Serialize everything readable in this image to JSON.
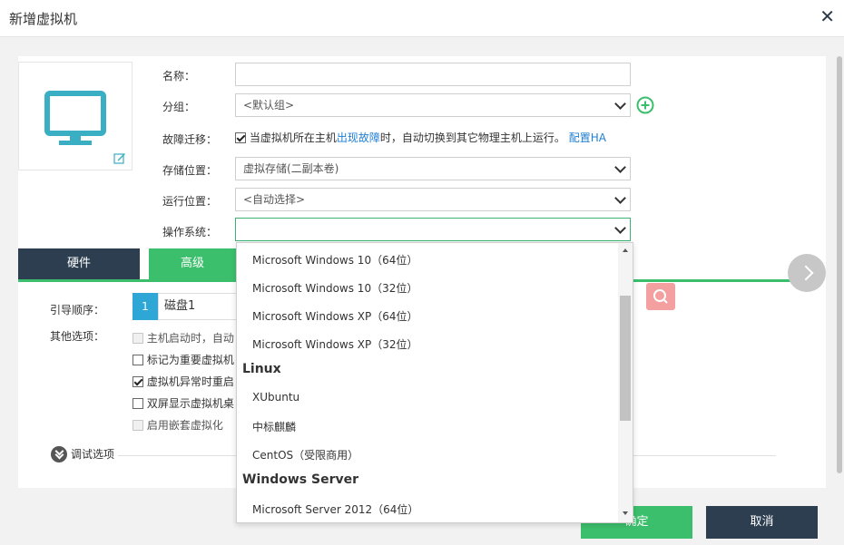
{
  "dialog": {
    "title": "新增虚拟机",
    "close_glyph": "✕"
  },
  "form": {
    "name_label": "名称：",
    "name_value": "",
    "group_label": "分组：",
    "group_value": "<默认组>",
    "failover_label": "故障迁移：",
    "failover_text_1": "当虚拟机所在主机",
    "failover_link_1": "出现故障",
    "failover_text_2": "时，自动切换到其它物理主机上运行。",
    "failover_link_2": "配置HA",
    "failover_checked": true,
    "storage_label": "存储位置：",
    "storage_value": "虚拟存储(二副本卷)",
    "run_label": "运行位置：",
    "run_value": "<自动选择>",
    "os_label": "操作系统：",
    "os_value": ""
  },
  "tabs": {
    "hardware": "硬件",
    "advanced": "高级"
  },
  "advanced": {
    "boot_label": "引导顺序：",
    "boot_index": "1",
    "boot_device": "磁盘1",
    "other_label": "其他选项：",
    "options": [
      {
        "label": "主机启动时，自动",
        "checked": false,
        "disabled": true
      },
      {
        "label": "标记为重要虚拟机",
        "checked": false,
        "disabled": false
      },
      {
        "label": "虚拟机异常时重启",
        "checked": true,
        "disabled": false
      },
      {
        "label": "双屏显示虚拟机桌",
        "checked": false,
        "disabled": false
      },
      {
        "label": "启用嵌套虚拟化",
        "checked": false,
        "disabled": true
      }
    ],
    "debug_label": "调试选项"
  },
  "os_dropdown": {
    "items": [
      {
        "kind": "item",
        "label": "Microsoft Windows 10（64位）"
      },
      {
        "kind": "item",
        "label": "Microsoft Windows 10（32位）"
      },
      {
        "kind": "item",
        "label": "Microsoft Windows XP（64位）"
      },
      {
        "kind": "item",
        "label": "Microsoft Windows XP（32位）"
      },
      {
        "kind": "group",
        "label": "Linux"
      },
      {
        "kind": "item",
        "label": "XUbuntu"
      },
      {
        "kind": "item",
        "label": "中标麒麟"
      },
      {
        "kind": "item",
        "label": "CentOS（受限商用）"
      },
      {
        "kind": "group",
        "label": "Windows Server"
      },
      {
        "kind": "item",
        "label": "Microsoft Server 2012（64位）"
      }
    ]
  },
  "footer": {
    "ok": "确定",
    "cancel": "取消"
  },
  "colors": {
    "accent_green": "#3cbf6c",
    "dark_navy": "#2c3e50",
    "link_blue": "#1f7fd0",
    "monitor_teal": "#3aaec2"
  }
}
